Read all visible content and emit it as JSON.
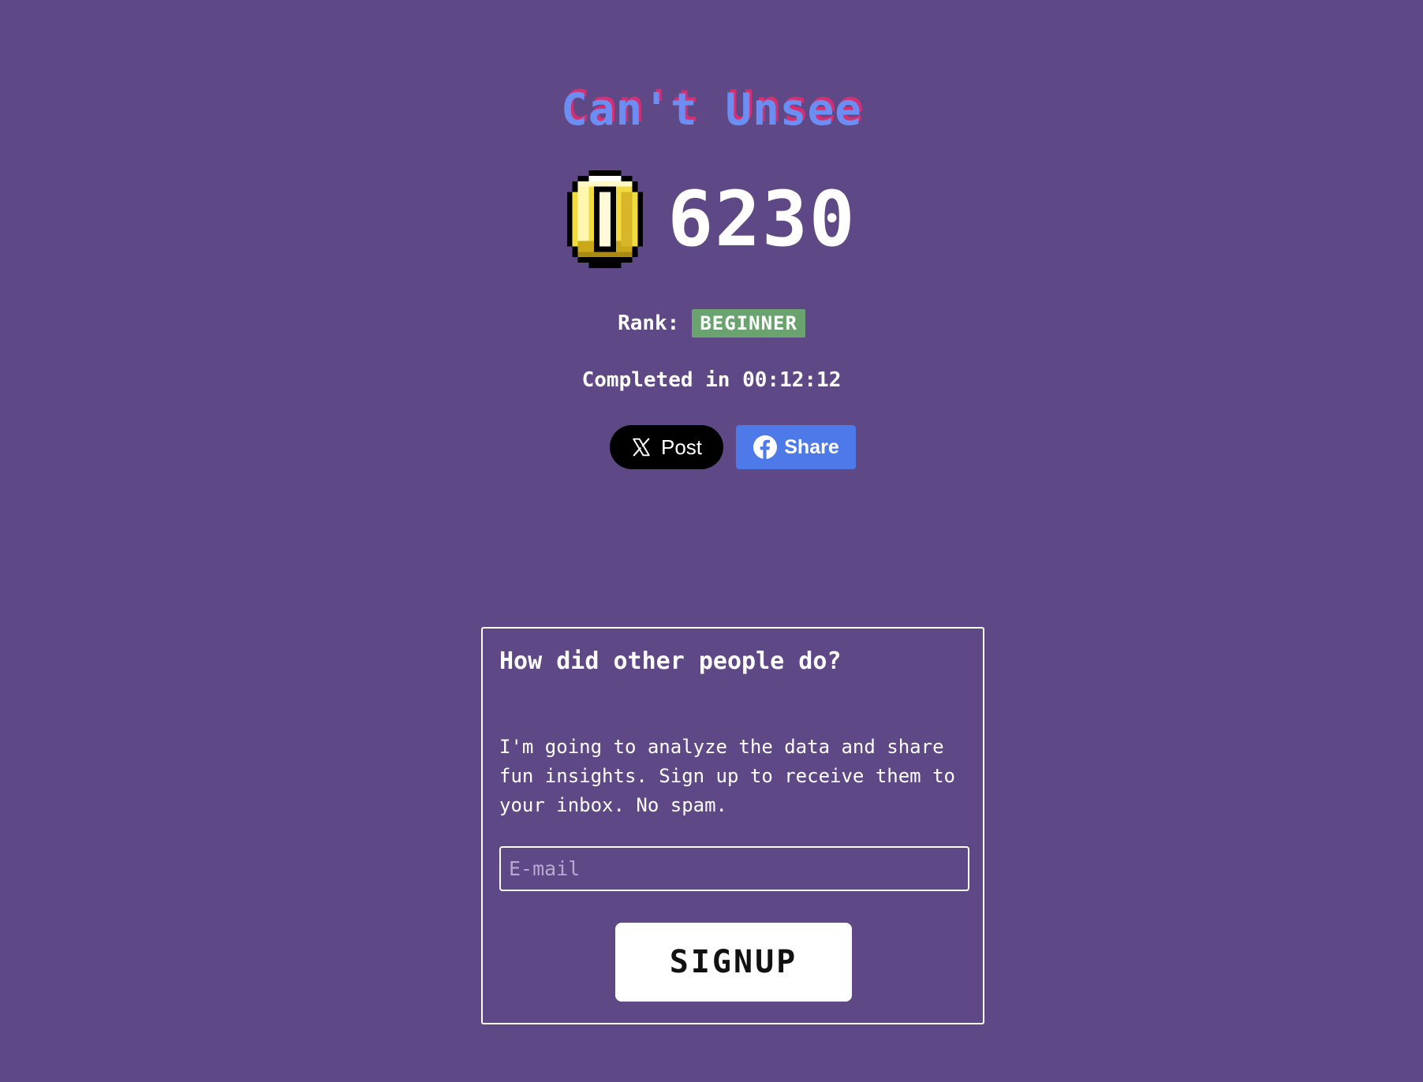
{
  "header": {
    "title": "Can't Unsee"
  },
  "score": {
    "icon": "coin-icon",
    "value": "6230"
  },
  "rank": {
    "label": "Rank:",
    "value": "BEGINNER",
    "badge_color": "#6aa36f"
  },
  "completion": {
    "text": "Completed in 00:12:12"
  },
  "share": {
    "x_label": "Post",
    "x_icon": "x-logo-icon",
    "facebook_label": "Share",
    "facebook_icon": "facebook-icon",
    "facebook_color": "#4e79e9"
  },
  "signup": {
    "title": "How did other people do?",
    "description": "I'm going to analyze the data and share fun insights. Sign up to receive them to your inbox. No spam.",
    "email_placeholder": "E-mail",
    "email_value": "",
    "button_label": "SIGNUP"
  },
  "colors": {
    "background": "#5f4886",
    "title_primary": "#6c8df2",
    "title_shadow": "#d52f72"
  }
}
